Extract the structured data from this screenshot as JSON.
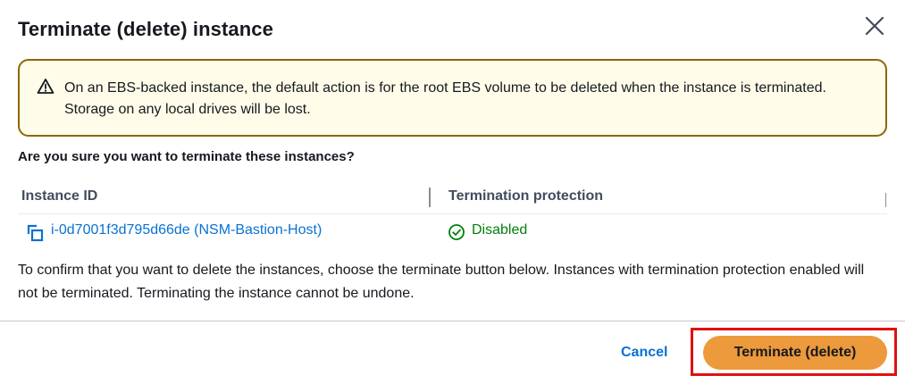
{
  "modal": {
    "title": "Terminate (delete) instance",
    "close_icon": "close-icon"
  },
  "warning": {
    "icon": "warning-triangle-icon",
    "text": "On an EBS-backed instance, the default action is for the root EBS volume to be deleted when the instance is terminated. Storage on any local drives will be lost."
  },
  "question": "Are you sure you want to terminate these instances?",
  "table": {
    "columns": [
      "Instance ID",
      "Termination protection"
    ],
    "rows": [
      {
        "copy_icon": "copy-icon",
        "instance": "i-0d7001f3d795d66de (NSM-Bastion-Host)",
        "status_icon": "check-circle-icon",
        "protection": "Disabled"
      }
    ]
  },
  "confirm_text": "To confirm that you want to delete the instances, choose the terminate button below. Instances with termination protection enabled will not be terminated. Terminating the instance cannot be undone.",
  "footer": {
    "cancel_label": "Cancel",
    "terminate_label": "Terminate (delete)"
  },
  "colors": {
    "warning_bg": "#fffce9",
    "warning_border": "#8d6605",
    "link": "#0972d3",
    "success": "#037f0c",
    "primary_button": "#ec9a3c",
    "highlight": "#e01010"
  }
}
